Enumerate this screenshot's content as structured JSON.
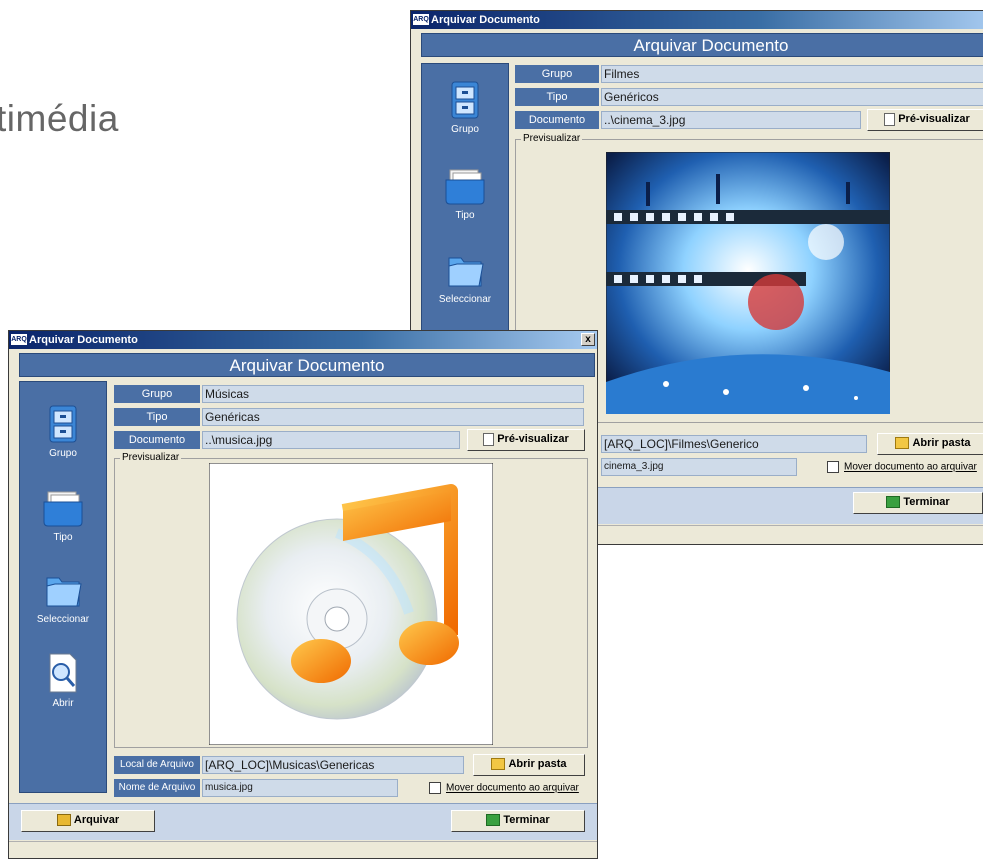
{
  "slide": {
    "title_fragment": "timédia"
  },
  "back_window": {
    "titlebar": {
      "logo": "ARQ",
      "title": "Arquivar Documento"
    },
    "header": "Arquivar Documento",
    "sidebar": [
      {
        "label": "Grupo",
        "icon": "cabinet-icon"
      },
      {
        "label": "Tipo",
        "icon": "folder-stack-icon"
      },
      {
        "label": "Seleccionar",
        "icon": "folder-icon"
      }
    ],
    "fields": {
      "grupo_label": "Grupo",
      "grupo_value": "Filmes",
      "tipo_label": "Tipo",
      "tipo_value": "Genéricos",
      "documento_label": "Documento",
      "documento_value": "..\\cinema_3.jpg"
    },
    "preview_button": "Pré-visualizar",
    "preview_legend": "Previsualizar",
    "local_value": "[ARQ_LOC]\\Filmes\\Generico",
    "abrir_pasta": "Abrir pasta",
    "nome_value": "cinema_3.jpg",
    "mover_label": "Mover documento ao arquivar",
    "terminar": "Terminar"
  },
  "front_window": {
    "titlebar": {
      "logo": "ARQ",
      "title": "Arquivar Documento",
      "close": "x"
    },
    "header": "Arquivar Documento",
    "sidebar": [
      {
        "label": "Grupo",
        "icon": "cabinet-icon"
      },
      {
        "label": "Tipo",
        "icon": "folder-stack-icon"
      },
      {
        "label": "Seleccionar",
        "icon": "folder-icon"
      },
      {
        "label": "Abrir",
        "icon": "magnifier-document-icon"
      }
    ],
    "fields": {
      "grupo_label": "Grupo",
      "grupo_value": "Músicas",
      "tipo_label": "Tipo",
      "tipo_value": "Genéricas",
      "documento_label": "Documento",
      "documento_value": "..\\musica.jpg"
    },
    "preview_button": "Pré-visualizar",
    "preview_legend": "Previsualizar",
    "local_label": "Local de Arquivo",
    "local_value": "[ARQ_LOC]\\Musicas\\Genericas",
    "abrir_pasta": "Abrir pasta",
    "nome_label": "Nome de Arquivo",
    "nome_value": "musica.jpg",
    "mover_label": "Mover documento ao arquivar",
    "arquivar": "Arquivar",
    "terminar": "Terminar"
  },
  "colors": {
    "accent_blue": "#4a6fa5",
    "field_bg": "#cfdbe9",
    "note_orange": "#f39a1a"
  }
}
